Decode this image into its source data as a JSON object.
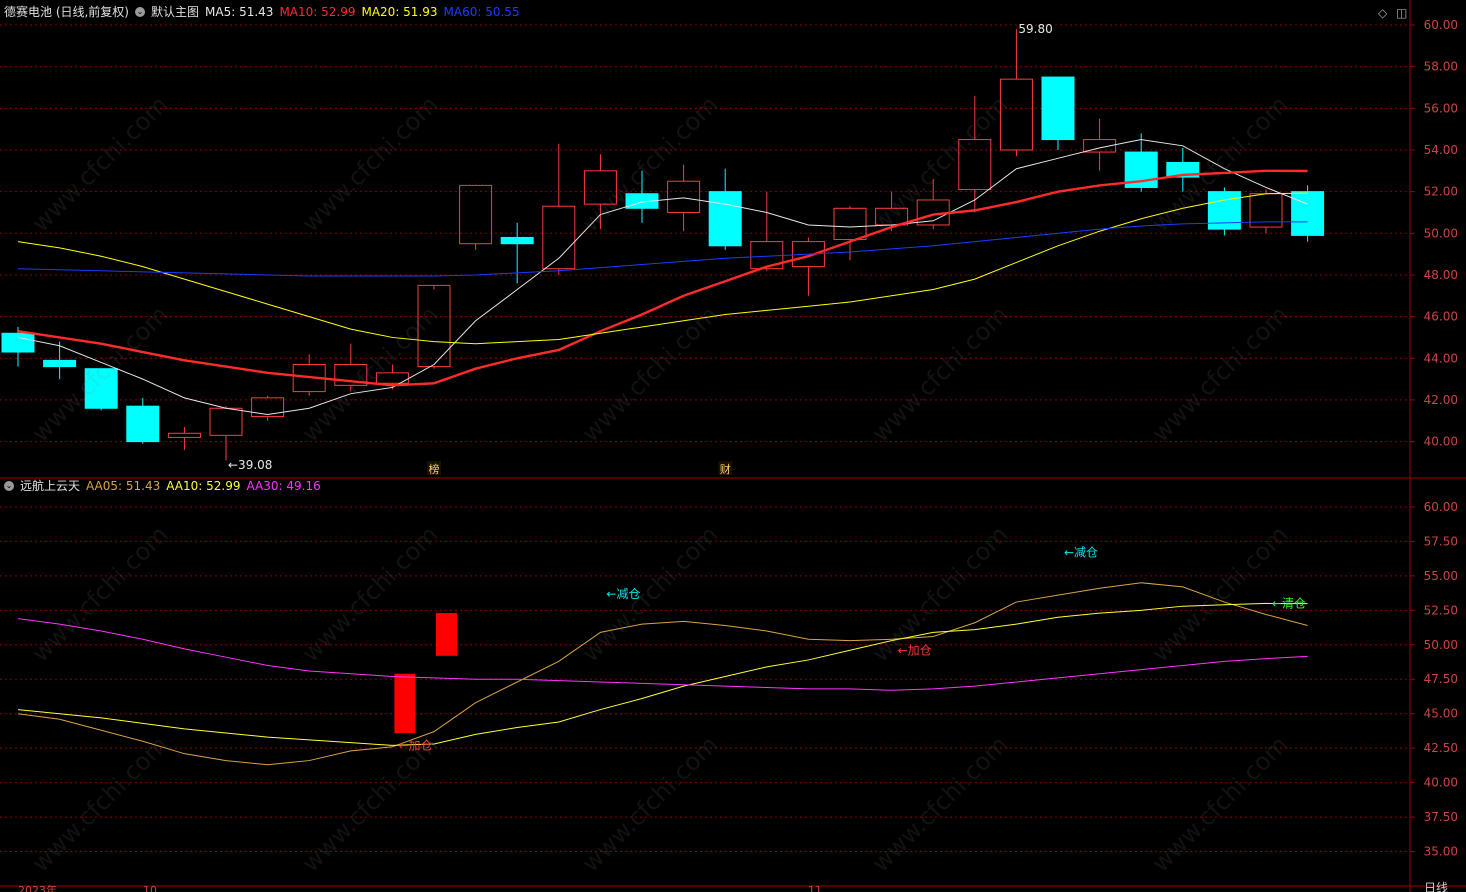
{
  "main_header": {
    "title": "德赛电池 (日线,前复权)",
    "template": "默认主图",
    "ma": [
      {
        "label": "MA5: 51.43",
        "color": "#e6e6e6"
      },
      {
        "label": "MA10: 52.99",
        "color": "#ff2a2a"
      },
      {
        "label": "MA20: 51.93",
        "color": "#ffff00"
      },
      {
        "label": "MA60: 50.55",
        "color": "#1a3cff"
      }
    ]
  },
  "sub_header": {
    "title": "远航上云天",
    "aa": [
      {
        "label": "AA05: 51.43",
        "color": "#d9a441"
      },
      {
        "label": "AA10: 52.99",
        "color": "#ffff33"
      },
      {
        "label": "AA30: 49.16",
        "color": "#ff33ff"
      }
    ]
  },
  "watermark": "www.cfchi.com",
  "colors": {
    "up": "#ff3b3b",
    "down": "#00ffff",
    "grid": "#8b0000",
    "axis_text": "#cc4444"
  },
  "chart_data": [
    {
      "type": "candlestick",
      "y_ticks": [
        40,
        42,
        44,
        46,
        48,
        50,
        52,
        54,
        56,
        58,
        60
      ],
      "ylim": [
        38.3,
        61.2
      ],
      "candles": [
        {
          "o": 45.2,
          "h": 45.5,
          "l": 43.6,
          "c": 44.3
        },
        {
          "o": 43.9,
          "h": 44.8,
          "l": 43.0,
          "c": 43.6
        },
        {
          "o": 43.5,
          "h": 43.5,
          "l": 41.5,
          "c": 41.6
        },
        {
          "o": 41.7,
          "h": 42.1,
          "l": 39.9,
          "c": 40.0
        },
        {
          "o": 40.2,
          "h": 40.7,
          "l": 39.6,
          "c": 40.4
        },
        {
          "o": 40.3,
          "h": 41.7,
          "l": 39.1,
          "c": 41.6
        },
        {
          "o": 41.2,
          "h": 42.2,
          "l": 41.0,
          "c": 42.1
        },
        {
          "o": 42.4,
          "h": 44.2,
          "l": 42.2,
          "c": 43.7
        },
        {
          "o": 42.7,
          "h": 44.7,
          "l": 42.4,
          "c": 43.7
        },
        {
          "o": 42.8,
          "h": 43.7,
          "l": 42.5,
          "c": 43.3
        },
        {
          "o": 43.6,
          "h": 47.3,
          "l": 43.5,
          "c": 47.5
        },
        {
          "o": 49.5,
          "h": 52.3,
          "l": 49.2,
          "c": 52.3
        },
        {
          "o": 49.8,
          "h": 50.5,
          "l": 47.6,
          "c": 49.5
        },
        {
          "o": 48.3,
          "h": 54.3,
          "l": 48.0,
          "c": 51.3
        },
        {
          "o": 51.4,
          "h": 53.8,
          "l": 50.2,
          "c": 53.0
        },
        {
          "o": 51.9,
          "h": 53.0,
          "l": 50.5,
          "c": 51.2
        },
        {
          "o": 51.0,
          "h": 53.3,
          "l": 50.1,
          "c": 52.5
        },
        {
          "o": 52.0,
          "h": 53.1,
          "l": 49.2,
          "c": 49.4
        },
        {
          "o": 48.3,
          "h": 52.0,
          "l": 48.2,
          "c": 49.6
        },
        {
          "o": 48.4,
          "h": 49.8,
          "l": 47.0,
          "c": 49.6
        },
        {
          "o": 49.7,
          "h": 51.3,
          "l": 48.7,
          "c": 51.2
        },
        {
          "o": 50.4,
          "h": 52.0,
          "l": 50.1,
          "c": 51.2
        },
        {
          "o": 50.4,
          "h": 52.6,
          "l": 50.2,
          "c": 51.6
        },
        {
          "o": 52.1,
          "h": 56.6,
          "l": 51.0,
          "c": 54.5
        },
        {
          "o": 54.0,
          "h": 59.8,
          "l": 53.7,
          "c": 57.4
        },
        {
          "o": 57.5,
          "h": 57.5,
          "l": 54.0,
          "c": 54.5
        },
        {
          "o": 53.9,
          "h": 55.5,
          "l": 53.0,
          "c": 54.5
        },
        {
          "o": 53.9,
          "h": 54.8,
          "l": 52.0,
          "c": 52.2
        },
        {
          "o": 53.4,
          "h": 54.1,
          "l": 52.0,
          "c": 52.7
        },
        {
          "o": 52.0,
          "h": 52.2,
          "l": 49.9,
          "c": 50.2
        },
        {
          "o": 50.3,
          "h": 52.1,
          "l": 50.0,
          "c": 51.9
        },
        {
          "o": 52.0,
          "h": 52.3,
          "l": 49.6,
          "c": 49.9
        }
      ],
      "series": [
        {
          "name": "MA5",
          "color": "#e6e6e6",
          "width": 1,
          "values": [
            45.0,
            44.6,
            43.8,
            43.0,
            42.1,
            41.6,
            41.3,
            41.6,
            42.3,
            42.6,
            43.7,
            45.8,
            47.3,
            48.8,
            50.9,
            51.5,
            51.7,
            51.4,
            51.0,
            50.4,
            50.3,
            50.4,
            50.6,
            51.6,
            53.1,
            53.6,
            54.1,
            54.5,
            54.2,
            53.1,
            52.2,
            51.4
          ]
        },
        {
          "name": "MA10",
          "color": "#ff2a2a",
          "width": 2.4,
          "values": [
            45.3,
            45.0,
            44.7,
            44.3,
            43.9,
            43.6,
            43.3,
            43.1,
            42.9,
            42.7,
            42.8,
            43.5,
            44.0,
            44.4,
            45.3,
            46.1,
            47.0,
            47.7,
            48.4,
            48.9,
            49.6,
            50.3,
            50.9,
            51.1,
            51.5,
            52.0,
            52.3,
            52.5,
            52.8,
            52.9,
            53.0,
            52.99
          ]
        },
        {
          "name": "MA20",
          "color": "#ffff00",
          "width": 1,
          "values": [
            49.6,
            49.3,
            48.9,
            48.4,
            47.8,
            47.2,
            46.6,
            46.0,
            45.4,
            45.0,
            44.8,
            44.7,
            44.8,
            44.9,
            45.2,
            45.5,
            45.8,
            46.1,
            46.3,
            46.5,
            46.7,
            47.0,
            47.3,
            47.8,
            48.6,
            49.4,
            50.1,
            50.7,
            51.2,
            51.6,
            51.9,
            51.93
          ]
        },
        {
          "name": "MA60",
          "color": "#1a3cff",
          "width": 1,
          "values": [
            48.3,
            48.25,
            48.2,
            48.15,
            48.1,
            48.05,
            48.0,
            47.95,
            47.95,
            47.95,
            47.95,
            48.0,
            48.1,
            48.2,
            48.35,
            48.5,
            48.65,
            48.8,
            48.9,
            49.0,
            49.1,
            49.25,
            49.4,
            49.6,
            49.8,
            50.0,
            50.2,
            50.35,
            50.45,
            50.5,
            50.55,
            50.55
          ]
        }
      ],
      "annotations": [
        {
          "text": "←39.08",
          "i": 5,
          "y": 39.08
        },
        {
          "text": "59.80",
          "i": 24,
          "y": 59.8
        }
      ],
      "markers": [
        {
          "text": "榜",
          "i": 10
        },
        {
          "text": "财",
          "i": 17
        }
      ]
    },
    {
      "type": "line",
      "y_ticks": [
        35,
        37.5,
        40,
        42.5,
        45,
        47.5,
        50,
        52.5,
        55,
        57.5,
        60
      ],
      "ylim": [
        32.5,
        62.1
      ],
      "bars": [
        {
          "i": 9,
          "from": 43.6,
          "to": 47.9
        },
        {
          "i": 10,
          "from": 49.2,
          "to": 52.3
        }
      ],
      "series": [
        {
          "name": "AA05",
          "color": "#d9a441",
          "width": 1,
          "values": [
            45.0,
            44.6,
            43.8,
            43.0,
            42.1,
            41.6,
            41.3,
            41.6,
            42.3,
            42.6,
            43.7,
            45.8,
            47.3,
            48.8,
            50.9,
            51.5,
            51.7,
            51.4,
            51.0,
            50.4,
            50.3,
            50.4,
            50.6,
            51.6,
            53.1,
            53.6,
            54.1,
            54.5,
            54.2,
            53.1,
            52.2,
            51.4
          ]
        },
        {
          "name": "AA10",
          "color": "#ffff33",
          "width": 1,
          "values": [
            45.3,
            45.0,
            44.7,
            44.3,
            43.9,
            43.6,
            43.3,
            43.1,
            42.9,
            42.7,
            42.8,
            43.5,
            44.0,
            44.4,
            45.3,
            46.1,
            47.0,
            47.7,
            48.4,
            48.9,
            49.6,
            50.3,
            50.9,
            51.1,
            51.5,
            52.0,
            52.3,
            52.5,
            52.8,
            52.9,
            53.0,
            52.99
          ]
        },
        {
          "name": "AA30",
          "color": "#ff33ff",
          "width": 1,
          "values": [
            51.9,
            51.5,
            51.0,
            50.4,
            49.7,
            49.1,
            48.5,
            48.1,
            47.9,
            47.7,
            47.6,
            47.5,
            47.5,
            47.4,
            47.3,
            47.2,
            47.1,
            47.0,
            46.9,
            46.8,
            46.8,
            46.7,
            46.8,
            47.0,
            47.3,
            47.6,
            47.9,
            48.2,
            48.5,
            48.8,
            49.0,
            49.16
          ]
        }
      ],
      "signals": [
        {
          "text": "←加仓",
          "i": 9,
          "y": 42.7,
          "color": "#ff3b3b"
        },
        {
          "text": "←减仓",
          "i": 14,
          "y": 53.7,
          "color": "#00e5e5"
        },
        {
          "text": "←加仓",
          "i": 21,
          "y": 49.6,
          "color": "#ff3b3b"
        },
        {
          "text": "←减仓",
          "i": 25,
          "y": 56.7,
          "color": "#00e5e5"
        },
        {
          "text": "←清仓",
          "i": 30,
          "y": 53.0,
          "color": "#33ff33"
        }
      ]
    }
  ],
  "right_axis_label": "日线",
  "bottom_labels": [
    "2023年",
    "10",
    "11"
  ]
}
